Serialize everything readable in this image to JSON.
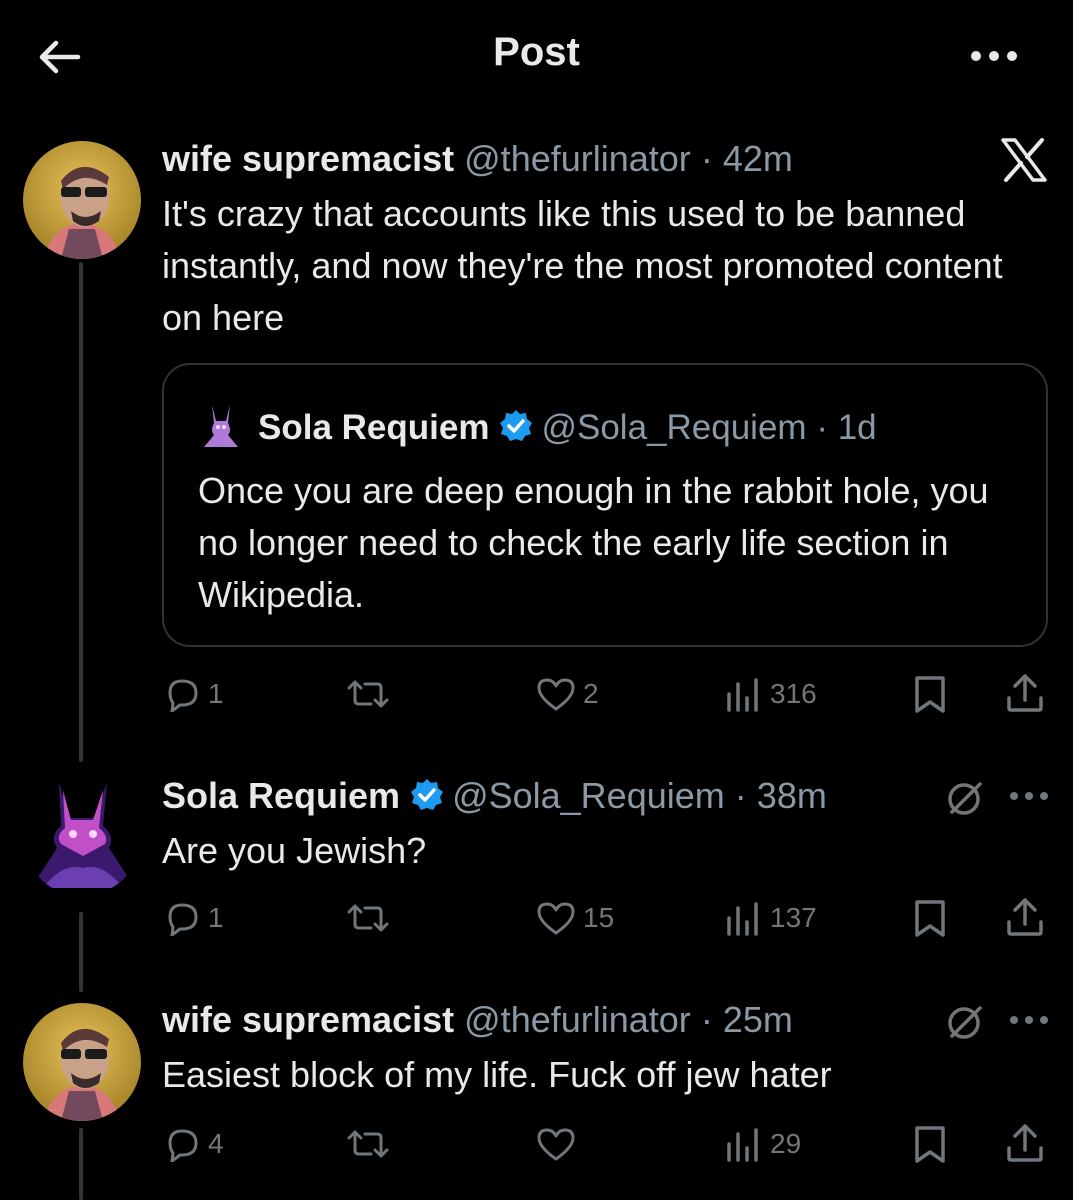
{
  "header": {
    "title": "Post"
  },
  "main_post": {
    "display_name": "wife supremacist",
    "handle": "@thefurlinator",
    "separator": "·",
    "time": "42m",
    "text": "It's crazy that accounts like this used to be banned instantly, and now they're the most promoted content on here",
    "quote": {
      "display_name": "Sola Requiem",
      "handle": "@Sola_Requiem",
      "separator": "·",
      "time": "1d",
      "text": "Once you are deep enough in the rabbit hole, you no longer need to check the early life section in Wikipedia."
    },
    "actions": {
      "replies": "1",
      "likes": "2",
      "views": "316"
    }
  },
  "reply_1": {
    "display_name": "Sola Requiem",
    "handle": "@Sola_Requiem",
    "separator": "·",
    "time": "38m",
    "text": "Are you Jewish?",
    "actions": {
      "replies": "1",
      "likes": "15",
      "views": "137"
    }
  },
  "reply_2": {
    "display_name": "wife supremacist",
    "handle": "@thefurlinator",
    "separator": "·",
    "time": "25m",
    "text": "Easiest block of my life. Fuck off jew hater",
    "actions": {
      "replies": "4",
      "views": "29"
    }
  },
  "colors": {
    "background": "#000000",
    "text": "#e7e9ea",
    "muted": "#71767b",
    "verified": "#1d9bf0",
    "border": "#2f3336"
  }
}
